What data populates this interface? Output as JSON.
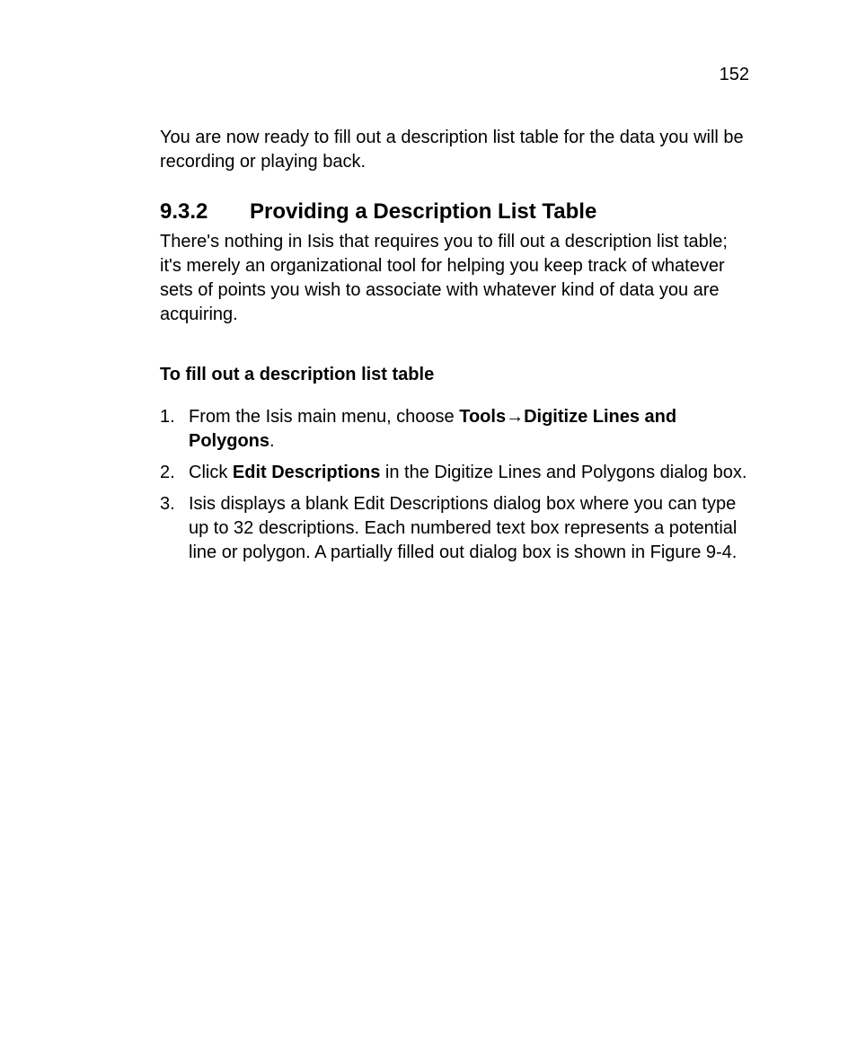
{
  "page_number": "152",
  "intro_paragraph": "You are now ready to fill out a description list table for the data you will be recording or playing back.",
  "section": {
    "number": "9.3.2",
    "title": "Providing a Description List Table",
    "paragraph": "There's nothing in Isis that requires you to fill out a description list table; it's merely an organizational tool for helping you keep track of whatever sets of points you wish to associate with whatever kind of data you are acquiring."
  },
  "procedure": {
    "heading": "To fill out a description list table",
    "steps": [
      {
        "n": "1.",
        "pre": "From the Isis main menu, choose ",
        "bold": "Tools→Digitize Lines and Polygons",
        "post": "."
      },
      {
        "n": "2.",
        "pre": "Click ",
        "bold": "Edit Descriptions",
        "post": " in the Digitize Lines and Polygons dialog box."
      },
      {
        "n": "3.",
        "pre": "Isis displays a blank Edit Descriptions dialog box where you can type up to 32 descriptions. Each numbered text box represents a potential line or polygon. A partially filled out dialog box is shown in Figure 9-4.",
        "bold": "",
        "post": ""
      }
    ]
  }
}
